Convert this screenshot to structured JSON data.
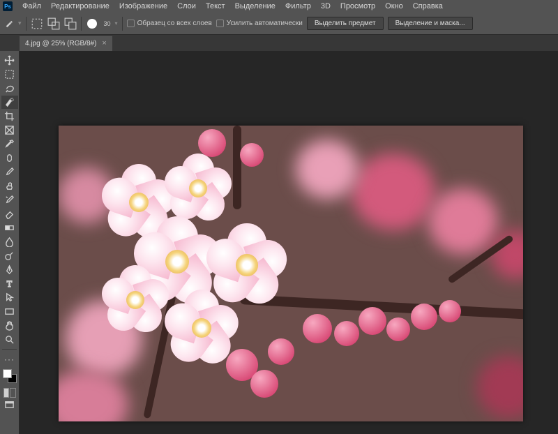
{
  "app": {
    "logo": "Ps"
  },
  "menu": [
    "Файл",
    "Редактирование",
    "Изображение",
    "Слои",
    "Текст",
    "Выделение",
    "Фильтр",
    "3D",
    "Просмотр",
    "Окно",
    "Справка"
  ],
  "options": {
    "brush_size": "30",
    "sample_all": "Образец со всех слоев",
    "auto_enhance": "Усилить автоматически",
    "select_subject": "Выделить предмет",
    "select_and_mask": "Выделение и маска..."
  },
  "tab": {
    "title": "4.jpg @ 25% (RGB/8#)",
    "close": "×"
  },
  "tools": [
    "move",
    "marquee",
    "lasso",
    "quick-select",
    "crop",
    "frame",
    "eyedropper",
    "healing",
    "brush",
    "clone",
    "history-brush",
    "eraser",
    "gradient",
    "blur",
    "dodge",
    "pen",
    "type",
    "path-select",
    "rectangle",
    "hand",
    "zoom"
  ],
  "colors": {
    "fg": "#ffffff",
    "bg": "#000000"
  }
}
